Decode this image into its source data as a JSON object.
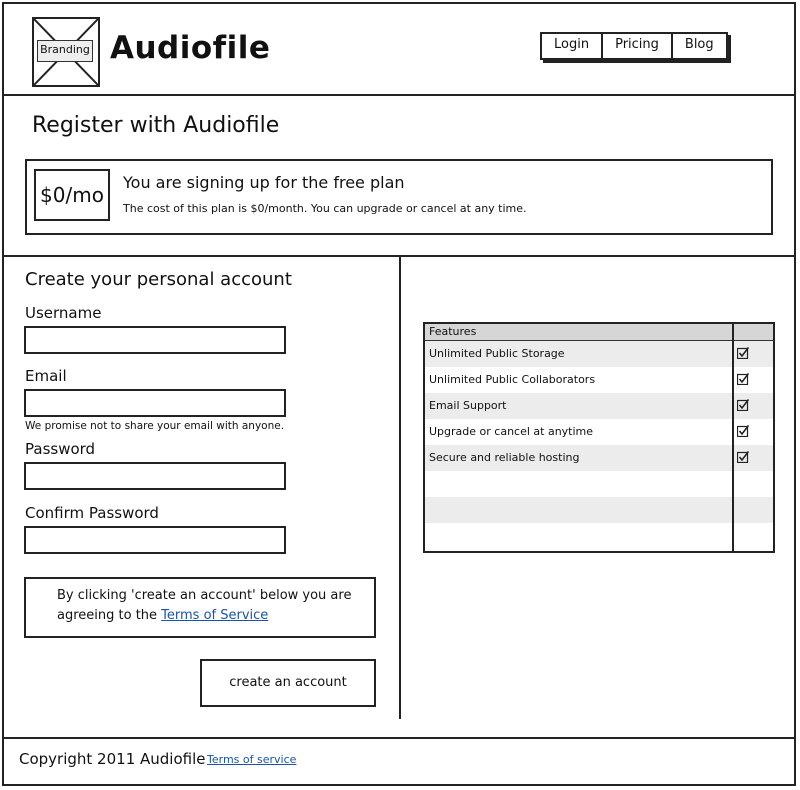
{
  "header": {
    "logo_label": "Branding",
    "app_title": "Audiofile",
    "nav": [
      "Login",
      "Pricing",
      "Blog"
    ]
  },
  "register": {
    "title": "Register with Audiofile",
    "plan_price": "$0/mo",
    "plan_heading": "You are signing up for the free plan",
    "plan_description": "The cost of this plan is $0/month. You can upgrade or cancel at any time."
  },
  "form": {
    "title": "Create your personal account",
    "username_label": "Username",
    "username_value": "",
    "email_label": "Email",
    "email_value": "",
    "email_hint": "We promise not to share your email with anyone.",
    "password_label": "Password",
    "password_value": "",
    "confirm_label": "Confirm Password",
    "confirm_value": "",
    "tos_text": "By clicking 'create an account' below you are agreeing to the",
    "tos_link": "Terms of Service",
    "submit_label": "create an account"
  },
  "features": {
    "header": "Features",
    "items": [
      {
        "label": "Unlimited Public Storage",
        "checked": true
      },
      {
        "label": "Unlimited Public Collaborators",
        "checked": true
      },
      {
        "label": "Email Support",
        "checked": true
      },
      {
        "label": "Upgrade or cancel at anytime",
        "checked": true
      },
      {
        "label": "Secure and reliable hosting",
        "checked": true
      }
    ]
  },
  "footer": {
    "copyright": "Copyright 2011 Audiofile",
    "terms_link": "Terms of service"
  }
}
